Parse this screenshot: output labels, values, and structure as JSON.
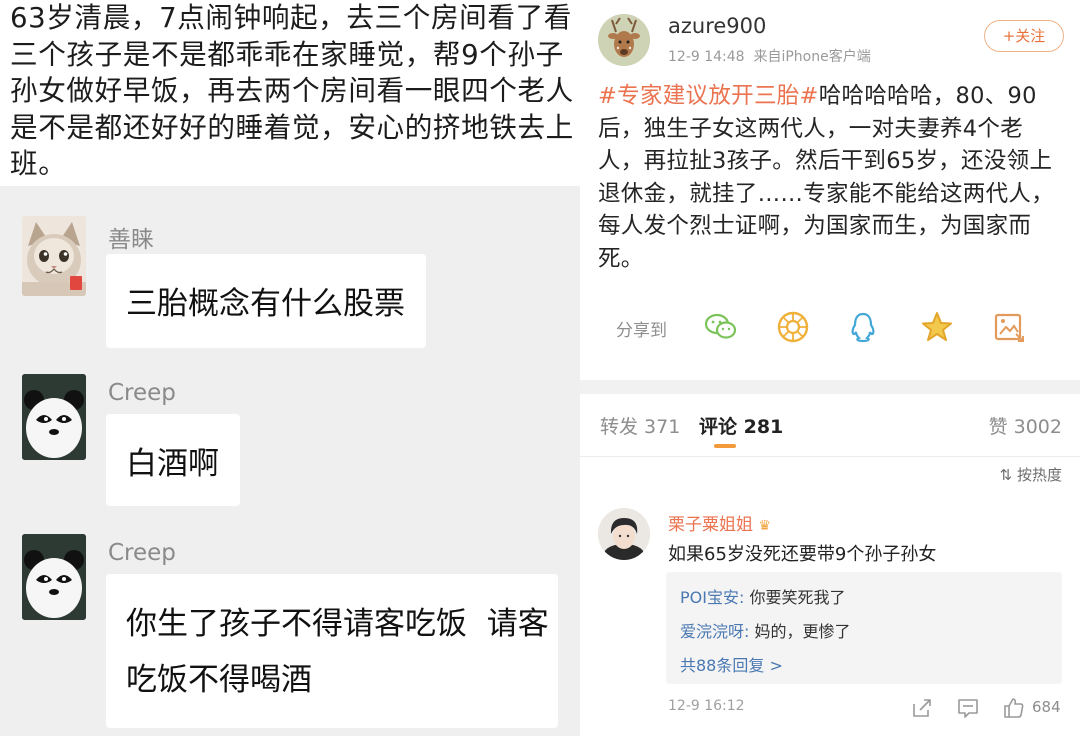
{
  "left": {
    "story": "63岁清晨，7点闹钟响起，去三个房间看了看三个孩子是不是都乖乖在家睡觉，帮9个孙子孙女做好早饭，再去两个房间看一眼四个老人是不是都还好好的睡着觉，安心的挤地铁去上班。",
    "messages": [
      {
        "sender": "善睐",
        "lines": [
          "三胎概念有什么股票"
        ],
        "avatar_icon": "cat-avatar"
      },
      {
        "sender": "Creep",
        "lines": [
          "白酒啊"
        ],
        "avatar_icon": "panda-avatar"
      },
      {
        "sender": "Creep",
        "lines": [
          "你生了孩子不得请客吃饭  请客",
          "吃饭不得喝酒"
        ],
        "avatar_icon": "panda-avatar"
      }
    ]
  },
  "right": {
    "post": {
      "username": "azure900",
      "meta": "12-9 14:48  来自iPhone客户端",
      "follow_label": "+关注",
      "hashtag": "#专家建议放开三胎#",
      "body_rest": "哈哈哈哈哈，80、90后，独生子女这两代人，一对夫妻养4个老人，再拉扯3孩子。然后干到65岁，还没领上退休金，就挂了……专家能不能给这两代人，每人发个烈士证啊，为国家而生，为国家而死。",
      "share_label": "分享到",
      "share_icons": [
        "wechat-icon",
        "moments-icon",
        "qq-icon",
        "qzone-star-icon",
        "image-share-icon"
      ]
    },
    "tabs": {
      "repost": "转发 371",
      "comment": "评论 281",
      "like": "赞 3002",
      "sort": "按热度"
    },
    "comment": {
      "username": "栗子粟姐姐",
      "text": "如果65岁没死还要带9个孙子孙女",
      "replies": [
        {
          "name": "POI宝安:",
          "text": " 你要笑死我了"
        },
        {
          "name": "爱浣浣呀:",
          "text": " 妈的，更惨了"
        }
      ],
      "more_replies": "共88条回复 >",
      "time": "12-9 16:12",
      "likes": "684"
    },
    "colors": {
      "accent": "#eb7350",
      "link": "#4a78b2",
      "tab_underline": "#f39b3a"
    }
  }
}
